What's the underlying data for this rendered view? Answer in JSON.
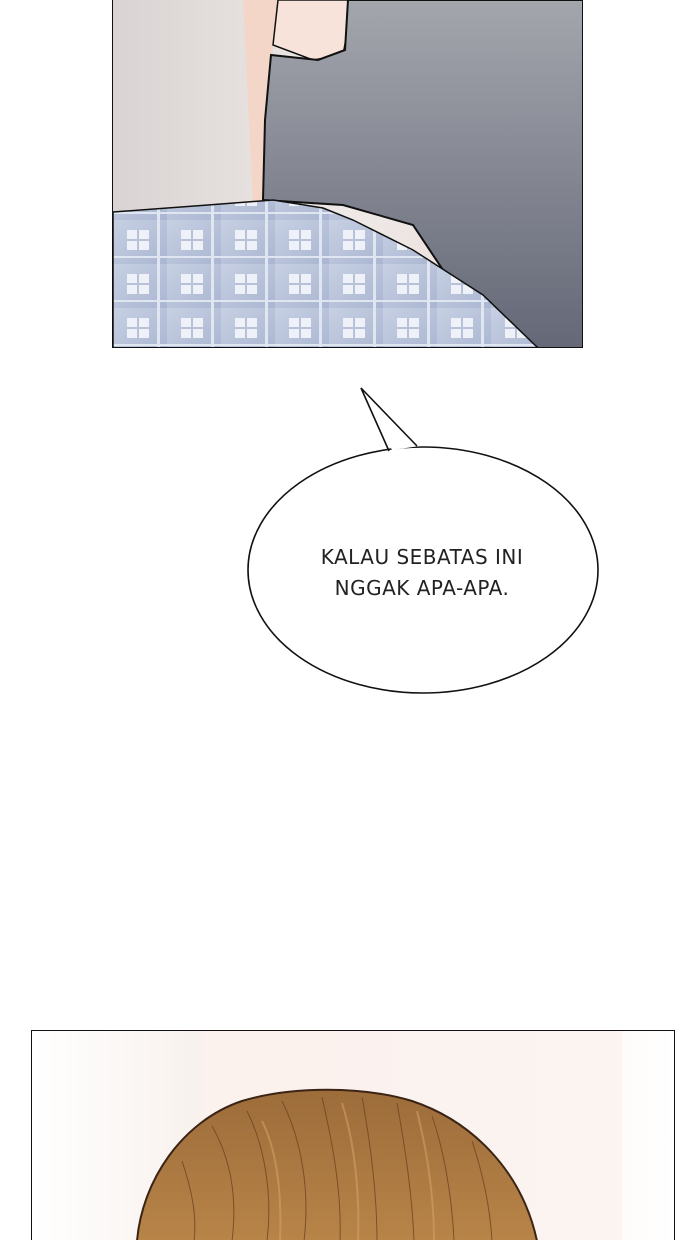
{
  "speech_bubble": {
    "lines": [
      "KALAU SEBATAS INI",
      "NGGAK APA-APA."
    ]
  },
  "colors": {
    "background": "#ffffff",
    "panel_border": "#111111",
    "shirt_dark": "#6e7180",
    "plaid_blue": "#bcc7dd",
    "hair_brown": "#a8763e",
    "skin": "#f2d9cc"
  }
}
